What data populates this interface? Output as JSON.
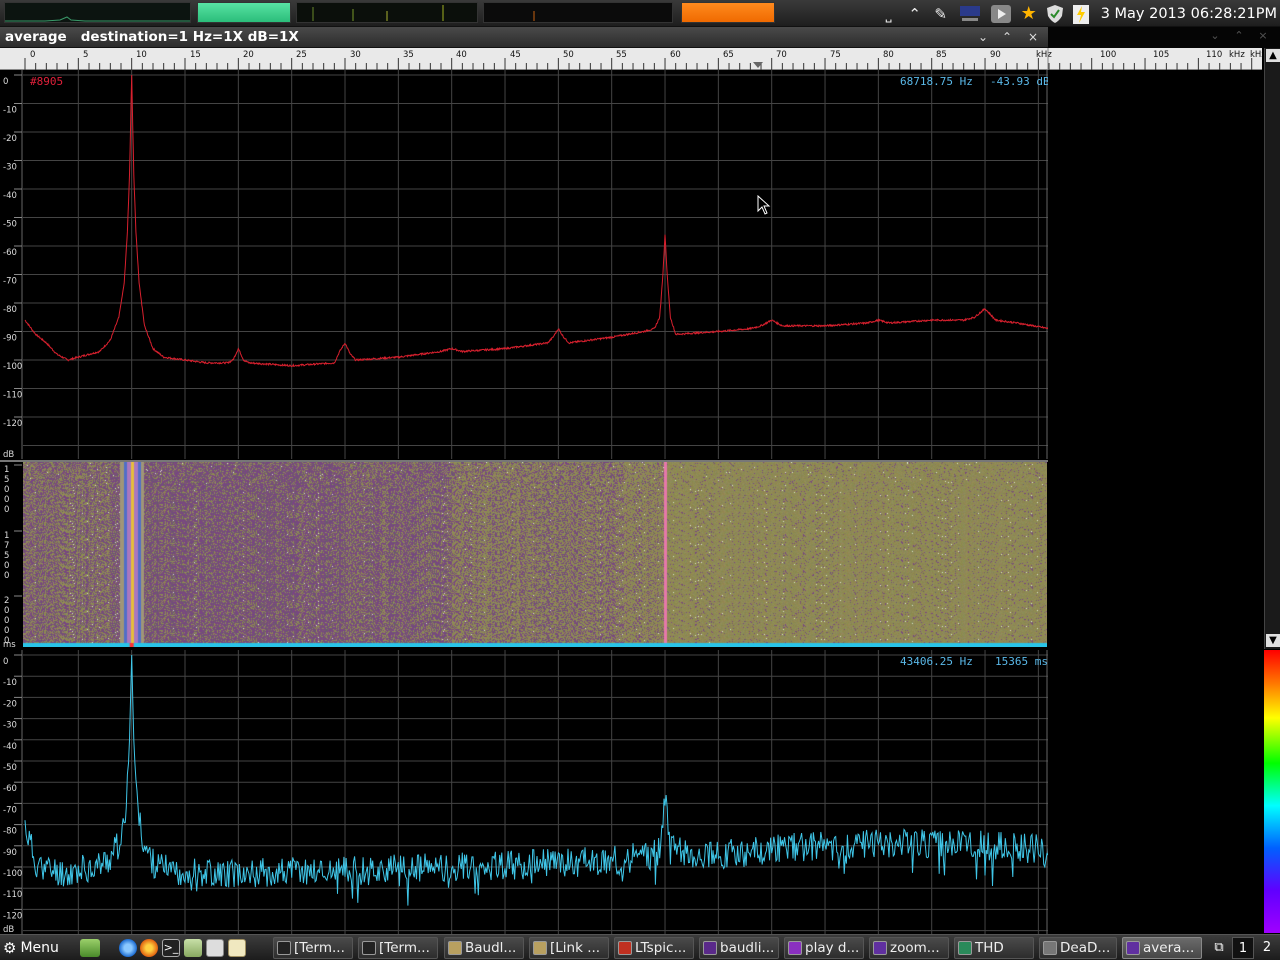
{
  "panel_top": {
    "clock": "3 May 2013 06:28:21PM"
  },
  "window": {
    "title": "average   destination=1 Hz=1X dB=1X",
    "minimize": "⌄",
    "maximize": "⌃",
    "close": "×"
  },
  "ruler": {
    "ticks": [
      "0",
      "5",
      "10",
      "15",
      "20",
      "25",
      "30",
      "35",
      "40",
      "45",
      "50",
      "55",
      "60",
      "65",
      "70",
      "75",
      "80",
      "85",
      "90",
      "kHz",
      "100",
      "105",
      "110",
      "kHz",
      "kHz"
    ]
  },
  "spectrum": {
    "marker_label": "#8905",
    "readout_freq": "68718.75 Hz",
    "readout_db": "-43.93 dB",
    "y_ticks": [
      "0",
      "-10",
      "-20",
      "-30",
      "-40",
      "-50",
      "-60",
      "-70",
      "-80",
      "-90",
      "-100",
      "-110",
      "-120"
    ],
    "y_unit": "dB",
    "line_color": "#d8202e"
  },
  "waterfall": {
    "time_groups": [
      [
        "1",
        "5",
        "0",
        "0",
        "0"
      ],
      [
        "1",
        "7",
        "5",
        "0",
        "0"
      ],
      [
        "2",
        "0",
        "0",
        "0",
        "0"
      ]
    ],
    "time_unit": "ms",
    "base_color": "#8a8660",
    "purple_color": "#7e4f86"
  },
  "slice": {
    "readout_freq": "43406.25 Hz",
    "readout_time": "15365 ms",
    "y_ticks": [
      "0",
      "-10",
      "-20",
      "-30",
      "-40",
      "-50",
      "-60",
      "-70",
      "-80",
      "-90",
      "-100",
      "-110",
      "-120"
    ],
    "y_unit": "dB",
    "line_color": "#3fc6e8"
  },
  "taskbar": {
    "menu_label": "Menu",
    "tasks": [
      {
        "label": "[Term...",
        "icon": "terminal-icon"
      },
      {
        "label": "[Term...",
        "icon": "terminal-icon"
      },
      {
        "label": "Baudl...",
        "icon": "folder-icon"
      },
      {
        "label": "[Link ...",
        "icon": "folder-icon"
      },
      {
        "label": "LTspic...",
        "icon": "ltspice-icon"
      },
      {
        "label": "baudli...",
        "icon": "baudline-icon"
      },
      {
        "label": "play d...",
        "icon": "play-icon"
      },
      {
        "label": "zoom...",
        "icon": "zoom-icon"
      },
      {
        "label": "THD",
        "icon": "thd-icon"
      },
      {
        "label": "DeaD...",
        "icon": "dead-icon"
      },
      {
        "label": "avera...",
        "icon": "average-icon"
      }
    ],
    "workspaces": [
      "1",
      "2"
    ]
  },
  "chart_data": [
    {
      "type": "line",
      "xlabel": "kHz",
      "ylabel": "dB",
      "xlim": [
        0,
        96
      ],
      "ylim": [
        -130,
        0
      ],
      "grid": true,
      "series": [
        {
          "name": "",
          "x": [
            0,
            1,
            2,
            3,
            4,
            5,
            6,
            7,
            8,
            8.8,
            9.3,
            9.6,
            9.8,
            10.0,
            10.2,
            10.4,
            10.7,
            11.2,
            12,
            13,
            15,
            17,
            19,
            19.5,
            20,
            20.5,
            21,
            25,
            29,
            29.5,
            30,
            30.5,
            31,
            35,
            39,
            40,
            41,
            45,
            49,
            49.5,
            50,
            50.5,
            51,
            55,
            58,
            59,
            59.5,
            59.8,
            60,
            60.2,
            60.5,
            61,
            65,
            68,
            69,
            70,
            71,
            75,
            79,
            80,
            81,
            85,
            88,
            89,
            90,
            91,
            93,
            96
          ],
          "y": [
            -86,
            -91,
            -94,
            -98,
            -100,
            -99,
            -98,
            -97,
            -93,
            -85,
            -73,
            -55,
            -35,
            0,
            -35,
            -55,
            -73,
            -88,
            -96,
            -99,
            -100,
            -101,
            -101,
            -100,
            -96,
            -100,
            -101,
            -102,
            -101,
            -97,
            -94,
            -98,
            -100,
            -99,
            -97,
            -96,
            -97,
            -96,
            -94,
            -92,
            -89,
            -92,
            -94,
            -92,
            -90,
            -89,
            -85,
            -70,
            -56,
            -70,
            -85,
            -91,
            -90,
            -89,
            -88,
            -86,
            -88,
            -88,
            -87,
            -86,
            -87,
            -86,
            -86,
            -85,
            -82,
            -86,
            -87,
            -89
          ]
        }
      ]
    },
    {
      "type": "heatmap",
      "xlabel": "kHz",
      "ylabel": "ms",
      "xlim": [
        0,
        96
      ],
      "notes": "spectrogram of the same signal; strong lines near 10 kHz and 60 kHz"
    },
    {
      "type": "line",
      "xlabel": "kHz",
      "ylabel": "dB",
      "xlim": [
        0,
        96
      ],
      "ylim": [
        -130,
        0
      ],
      "grid": true,
      "series": [
        {
          "name": "",
          "x": [
            0,
            1,
            2,
            4,
            6,
            7,
            8,
            8.8,
            9.3,
            9.6,
            9.8,
            10.0,
            10.2,
            10.4,
            10.7,
            11.2,
            12,
            13,
            15,
            20,
            25,
            30,
            35,
            40,
            45,
            50,
            55,
            58,
            59.5,
            60,
            60.5,
            62,
            65,
            68,
            70,
            75,
            80,
            85,
            90,
            93,
            96
          ],
          "y": [
            -80,
            -98,
            -101,
            -103,
            -100,
            -99,
            -96,
            -88,
            -78,
            -62,
            -40,
            0,
            -40,
            -62,
            -78,
            -90,
            -98,
            -101,
            -102,
            -103,
            -102,
            -102,
            -101,
            -100,
            -99,
            -98,
            -97,
            -95,
            -93,
            -66,
            -92,
            -93,
            -94,
            -93,
            -91,
            -90,
            -89,
            -89,
            -90,
            -91,
            -92
          ]
        }
      ]
    }
  ]
}
